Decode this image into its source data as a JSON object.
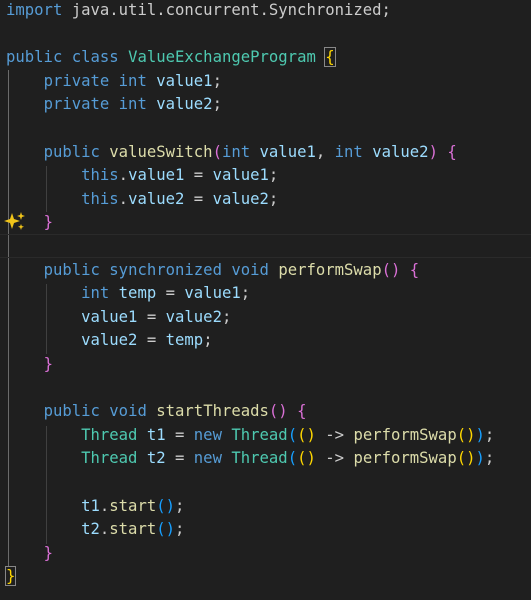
{
  "editor": {
    "language": "Java",
    "sparkle_icon": "sparkle-icon",
    "lines": [
      [
        {
          "t": "import",
          "c": "kw"
        },
        {
          "t": " java.util.concurrent.Synchronized;",
          "c": "pl"
        }
      ],
      [],
      [
        {
          "t": "public",
          "c": "kw"
        },
        {
          "t": " ",
          "c": "pl"
        },
        {
          "t": "class",
          "c": "kw"
        },
        {
          "t": " ",
          "c": "pl"
        },
        {
          "t": "ValueExchangeProgram",
          "c": "ty"
        },
        {
          "t": " ",
          "c": "pl"
        },
        {
          "t": "{",
          "c": "b1 match"
        }
      ],
      [
        {
          "t": "    ",
          "c": "pl"
        },
        {
          "t": "private",
          "c": "kw"
        },
        {
          "t": " ",
          "c": "pl"
        },
        {
          "t": "int",
          "c": "kw"
        },
        {
          "t": " ",
          "c": "pl"
        },
        {
          "t": "value1",
          "c": "var"
        },
        {
          "t": ";",
          "c": "pl"
        }
      ],
      [
        {
          "t": "    ",
          "c": "pl"
        },
        {
          "t": "private",
          "c": "kw"
        },
        {
          "t": " ",
          "c": "pl"
        },
        {
          "t": "int",
          "c": "kw"
        },
        {
          "t": " ",
          "c": "pl"
        },
        {
          "t": "value2",
          "c": "var"
        },
        {
          "t": ";",
          "c": "pl"
        }
      ],
      [],
      [
        {
          "t": "    ",
          "c": "pl"
        },
        {
          "t": "public",
          "c": "kw"
        },
        {
          "t": " ",
          "c": "pl"
        },
        {
          "t": "valueSwitch",
          "c": "fn"
        },
        {
          "t": "(",
          "c": "b2"
        },
        {
          "t": "int",
          "c": "kw"
        },
        {
          "t": " ",
          "c": "pl"
        },
        {
          "t": "value1",
          "c": "var"
        },
        {
          "t": ", ",
          "c": "pl"
        },
        {
          "t": "int",
          "c": "kw"
        },
        {
          "t": " ",
          "c": "pl"
        },
        {
          "t": "value2",
          "c": "var"
        },
        {
          "t": ")",
          "c": "b2"
        },
        {
          "t": " ",
          "c": "pl"
        },
        {
          "t": "{",
          "c": "b2"
        }
      ],
      [
        {
          "t": "        ",
          "c": "pl"
        },
        {
          "t": "this",
          "c": "kw"
        },
        {
          "t": ".",
          "c": "pl"
        },
        {
          "t": "value1",
          "c": "var"
        },
        {
          "t": " = ",
          "c": "pl"
        },
        {
          "t": "value1",
          "c": "var"
        },
        {
          "t": ";",
          "c": "pl"
        }
      ],
      [
        {
          "t": "        ",
          "c": "pl"
        },
        {
          "t": "this",
          "c": "kw"
        },
        {
          "t": ".",
          "c": "pl"
        },
        {
          "t": "value2",
          "c": "var"
        },
        {
          "t": " = ",
          "c": "pl"
        },
        {
          "t": "value2",
          "c": "var"
        },
        {
          "t": ";",
          "c": "pl"
        }
      ],
      [
        {
          "t": "    ",
          "c": "pl"
        },
        {
          "t": "}",
          "c": "b2"
        }
      ],
      [],
      [
        {
          "t": "    ",
          "c": "pl"
        },
        {
          "t": "public",
          "c": "kw"
        },
        {
          "t": " ",
          "c": "pl"
        },
        {
          "t": "synchronized",
          "c": "kw"
        },
        {
          "t": " ",
          "c": "pl"
        },
        {
          "t": "void",
          "c": "kw"
        },
        {
          "t": " ",
          "c": "pl"
        },
        {
          "t": "performSwap",
          "c": "fn"
        },
        {
          "t": "()",
          "c": "b2"
        },
        {
          "t": " ",
          "c": "pl"
        },
        {
          "t": "{",
          "c": "b2"
        }
      ],
      [
        {
          "t": "        ",
          "c": "pl"
        },
        {
          "t": "int",
          "c": "kw"
        },
        {
          "t": " ",
          "c": "pl"
        },
        {
          "t": "temp",
          "c": "var"
        },
        {
          "t": " = ",
          "c": "pl"
        },
        {
          "t": "value1",
          "c": "var"
        },
        {
          "t": ";",
          "c": "pl"
        }
      ],
      [
        {
          "t": "        ",
          "c": "pl"
        },
        {
          "t": "value1",
          "c": "var"
        },
        {
          "t": " = ",
          "c": "pl"
        },
        {
          "t": "value2",
          "c": "var"
        },
        {
          "t": ";",
          "c": "pl"
        }
      ],
      [
        {
          "t": "        ",
          "c": "pl"
        },
        {
          "t": "value2",
          "c": "var"
        },
        {
          "t": " = ",
          "c": "pl"
        },
        {
          "t": "temp",
          "c": "var"
        },
        {
          "t": ";",
          "c": "pl"
        }
      ],
      [
        {
          "t": "    ",
          "c": "pl"
        },
        {
          "t": "}",
          "c": "b2"
        }
      ],
      [],
      [
        {
          "t": "    ",
          "c": "pl"
        },
        {
          "t": "public",
          "c": "kw"
        },
        {
          "t": " ",
          "c": "pl"
        },
        {
          "t": "void",
          "c": "kw"
        },
        {
          "t": " ",
          "c": "pl"
        },
        {
          "t": "startThreads",
          "c": "fn"
        },
        {
          "t": "()",
          "c": "b2"
        },
        {
          "t": " ",
          "c": "pl"
        },
        {
          "t": "{",
          "c": "b2"
        }
      ],
      [
        {
          "t": "        ",
          "c": "pl"
        },
        {
          "t": "Thread",
          "c": "ty"
        },
        {
          "t": " ",
          "c": "pl"
        },
        {
          "t": "t1",
          "c": "var"
        },
        {
          "t": " = ",
          "c": "pl"
        },
        {
          "t": "new",
          "c": "kw"
        },
        {
          "t": " ",
          "c": "pl"
        },
        {
          "t": "Thread",
          "c": "ty"
        },
        {
          "t": "(",
          "c": "b3"
        },
        {
          "t": "()",
          "c": "b1"
        },
        {
          "t": " -> ",
          "c": "pl"
        },
        {
          "t": "performSwap",
          "c": "fn"
        },
        {
          "t": "()",
          "c": "b1"
        },
        {
          "t": ")",
          "c": "b3"
        },
        {
          "t": ";",
          "c": "pl"
        }
      ],
      [
        {
          "t": "        ",
          "c": "pl"
        },
        {
          "t": "Thread",
          "c": "ty"
        },
        {
          "t": " ",
          "c": "pl"
        },
        {
          "t": "t2",
          "c": "var"
        },
        {
          "t": " = ",
          "c": "pl"
        },
        {
          "t": "new",
          "c": "kw"
        },
        {
          "t": " ",
          "c": "pl"
        },
        {
          "t": "Thread",
          "c": "ty"
        },
        {
          "t": "(",
          "c": "b3"
        },
        {
          "t": "()",
          "c": "b1"
        },
        {
          "t": " -> ",
          "c": "pl"
        },
        {
          "t": "performSwap",
          "c": "fn"
        },
        {
          "t": "()",
          "c": "b1"
        },
        {
          "t": ")",
          "c": "b3"
        },
        {
          "t": ";",
          "c": "pl"
        }
      ],
      [],
      [
        {
          "t": "        ",
          "c": "pl"
        },
        {
          "t": "t1",
          "c": "var"
        },
        {
          "t": ".",
          "c": "pl"
        },
        {
          "t": "start",
          "c": "fn"
        },
        {
          "t": "()",
          "c": "b3"
        },
        {
          "t": ";",
          "c": "pl"
        }
      ],
      [
        {
          "t": "        ",
          "c": "pl"
        },
        {
          "t": "t2",
          "c": "var"
        },
        {
          "t": ".",
          "c": "pl"
        },
        {
          "t": "start",
          "c": "fn"
        },
        {
          "t": "()",
          "c": "b3"
        },
        {
          "t": ";",
          "c": "pl"
        }
      ],
      [
        {
          "t": "    ",
          "c": "pl"
        },
        {
          "t": "}",
          "c": "b2"
        }
      ],
      [
        {
          "t": "}",
          "c": "b1 match"
        }
      ]
    ]
  }
}
